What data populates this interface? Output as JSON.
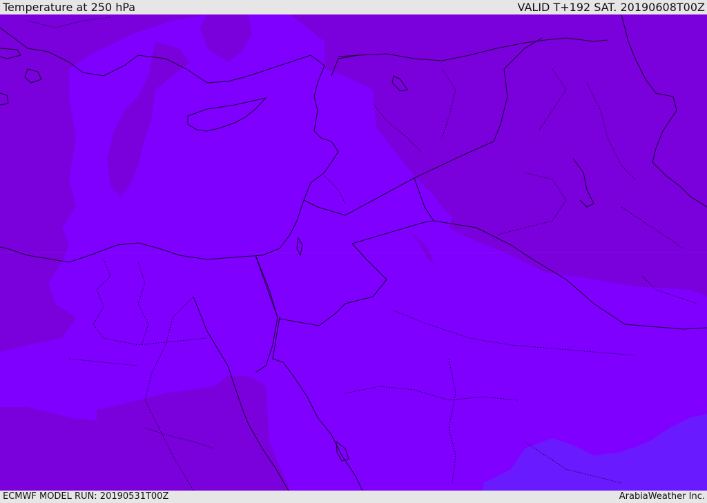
{
  "header": {
    "title": "Temperature at 250 hPa",
    "valid": "VALID T+192 SAT. 20190608T00Z"
  },
  "footer": {
    "model_run": "ECMWF MODEL RUN: 20190531T00Z",
    "credit": "ArabiaWeather Inc."
  },
  "map": {
    "field_colors": {
      "cold_band": "#7a00dc",
      "mid_band": "#7f00ff",
      "warm_band": "#6a1aff"
    }
  }
}
